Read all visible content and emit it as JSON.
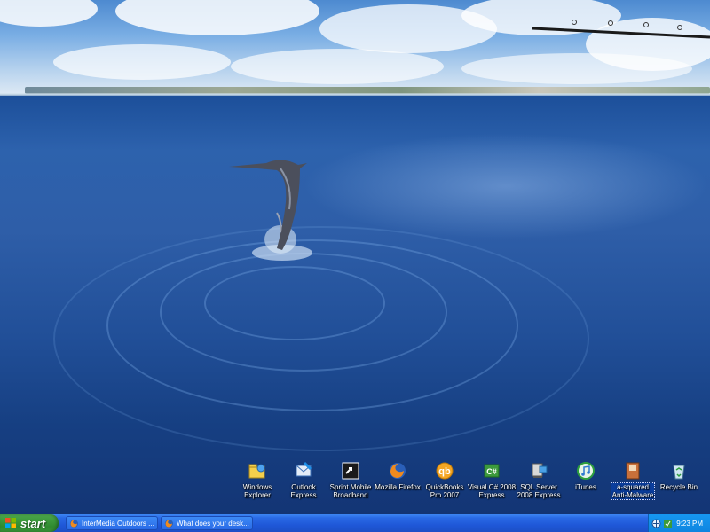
{
  "desktop": {
    "icons": [
      {
        "id": "windows-explorer",
        "label": "Windows\nExplorer",
        "icon": "folder-explorer-icon"
      },
      {
        "id": "outlook-express",
        "label": "Outlook\nExpress",
        "icon": "outlook-express-icon"
      },
      {
        "id": "sprint-mobile-broadband",
        "label": "Sprint Mobile\nBroadband",
        "icon": "sprint-shortcut-icon"
      },
      {
        "id": "mozilla-firefox",
        "label": "Mozilla Firefox",
        "icon": "firefox-icon"
      },
      {
        "id": "quickbooks",
        "label": "QuickBooks\nPro 2007",
        "icon": "quickbooks-icon"
      },
      {
        "id": "visual-csharp",
        "label": "Visual C# 2008\nExpress",
        "icon": "visual-csharp-icon"
      },
      {
        "id": "sql-server",
        "label": "SQL Server\n2008 Express",
        "icon": "sql-server-icon"
      },
      {
        "id": "itunes",
        "label": "iTunes",
        "icon": "itunes-icon"
      },
      {
        "id": "a-squared",
        "label": "a-squared\nAnti-Malware",
        "icon": "a-squared-icon"
      },
      {
        "id": "recycle-bin",
        "label": "Recycle Bin",
        "icon": "recycle-bin-icon"
      }
    ]
  },
  "taskbar": {
    "start_label": "start",
    "tasks": [
      {
        "label": "InterMedia Outdoors ...",
        "icon": "firefox-icon"
      },
      {
        "label": "What does your desk...",
        "icon": "firefox-icon"
      }
    ],
    "clock": "9:23 PM"
  },
  "colors": {
    "taskbar_blue": "#245edb",
    "start_green": "#3c9a3c",
    "tray_blue": "#0f85e0"
  }
}
